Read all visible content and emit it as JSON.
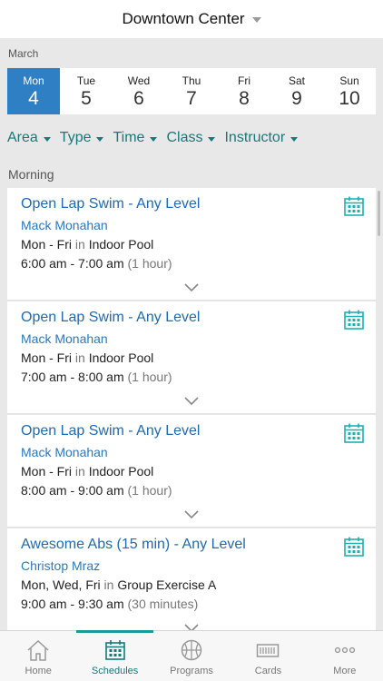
{
  "header": {
    "location": "Downtown Center"
  },
  "calendar": {
    "month": "March",
    "days": [
      {
        "name": "Mon",
        "num": "4"
      },
      {
        "name": "Tue",
        "num": "5"
      },
      {
        "name": "Wed",
        "num": "6"
      },
      {
        "name": "Thu",
        "num": "7"
      },
      {
        "name": "Fri",
        "num": "8"
      },
      {
        "name": "Sat",
        "num": "9"
      },
      {
        "name": "Sun",
        "num": "10"
      }
    ],
    "selected_index": 0
  },
  "filters": [
    "Area",
    "Type",
    "Time",
    "Class",
    "Instructor"
  ],
  "section": "Morning",
  "classes": [
    {
      "title": "Open Lap Swim - Any Level",
      "instructor": "Mack Monahan",
      "days": "Mon - Fri",
      "in_word": "in",
      "location": "Indoor Pool",
      "time": "6:00 am - 7:00 am",
      "duration": "(1 hour)"
    },
    {
      "title": "Open Lap Swim - Any Level",
      "instructor": "Mack Monahan",
      "days": "Mon - Fri",
      "in_word": "in",
      "location": "Indoor Pool",
      "time": "7:00 am - 8:00 am",
      "duration": "(1 hour)"
    },
    {
      "title": "Open Lap Swim - Any Level",
      "instructor": "Mack Monahan",
      "days": "Mon - Fri",
      "in_word": "in",
      "location": "Indoor Pool",
      "time": "8:00 am - 9:00 am",
      "duration": "(1 hour)"
    },
    {
      "title": "Awesome Abs (15 min) - Any Level",
      "instructor": "Christop Mraz",
      "days": "Mon, Wed, Fri",
      "in_word": "in",
      "location": "Group Exercise A",
      "time": "9:00 am - 9:30 am",
      "duration": "(30 minutes)"
    }
  ],
  "tabs": [
    {
      "label": "Home",
      "icon": "home-icon"
    },
    {
      "label": "Schedules",
      "icon": "calendar-icon",
      "active": true
    },
    {
      "label": "Programs",
      "icon": "basketball-icon"
    },
    {
      "label": "Cards",
      "icon": "card-icon"
    },
    {
      "label": "More",
      "icon": "more-icon"
    }
  ],
  "colors": {
    "accent": "#147a7a",
    "selected_day": "#2f7fc4",
    "link": "#1f6ab0"
  }
}
